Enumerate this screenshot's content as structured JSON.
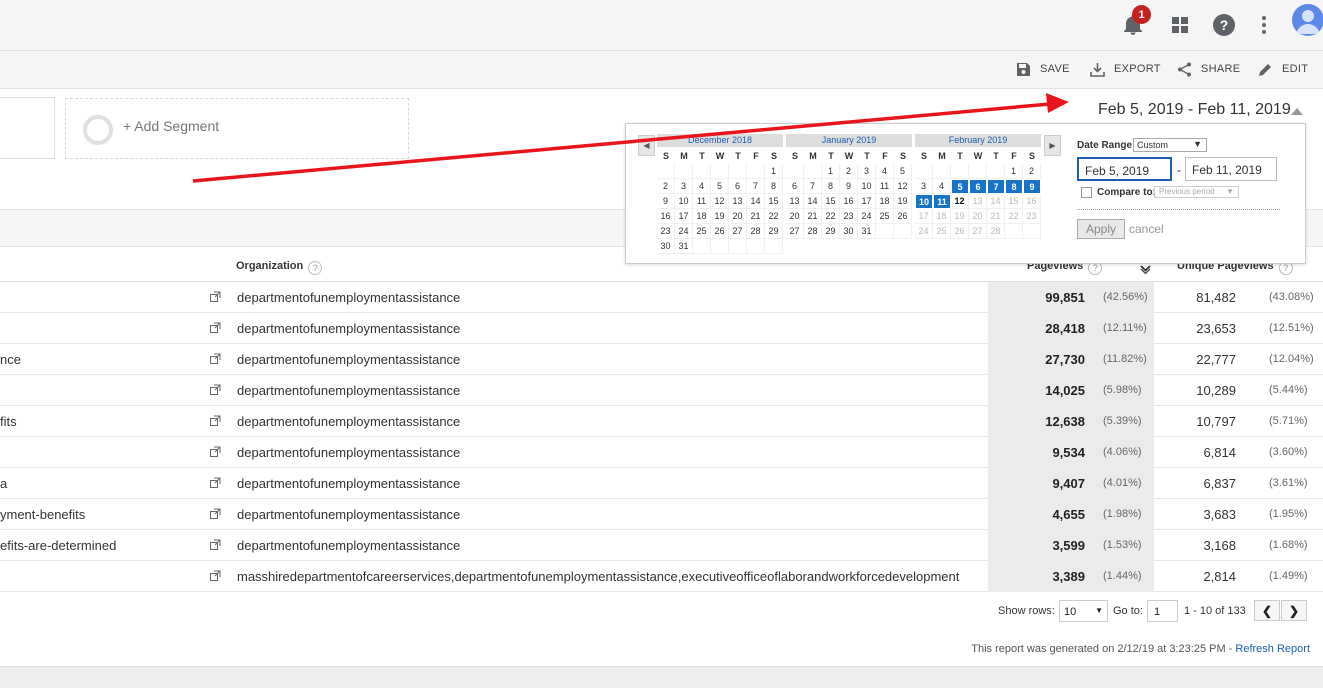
{
  "topbar": {
    "notification_count": "1"
  },
  "toolbar": {
    "save": "SAVE",
    "export": "EXPORT",
    "share": "SHARE",
    "edit": "EDIT"
  },
  "segments": {
    "add_segment": "+ Add Segment"
  },
  "date_range_display": "Feb 5, 2019 - Feb 11, 2019",
  "calendar": {
    "months": [
      {
        "title": "December 2018"
      },
      {
        "title": "January 2019"
      },
      {
        "title": "February 2019"
      }
    ],
    "weekdays": [
      "S",
      "M",
      "T",
      "W",
      "T",
      "F",
      "S"
    ],
    "date_range_label": "Date Range:",
    "date_range_option": "Custom",
    "start_date": "Feb 5, 2019",
    "end_date": "Feb 11, 2019",
    "separator": "-",
    "compare_label": "Compare to:",
    "compare_option": "Previous period",
    "apply": "Apply",
    "cancel": "cancel"
  },
  "table": {
    "headers": {
      "organization": "Organization",
      "pageviews": "Pageviews",
      "unique_pageviews": "Unique Pageviews",
      "help": "?"
    },
    "rows": [
      {
        "page": "",
        "org": "departmentofunemploymentassistance",
        "pv": "99,851",
        "pvp": "(42.56%)",
        "upv": "81,482",
        "upvp": "(43.08%)"
      },
      {
        "page": "",
        "org": "departmentofunemploymentassistance",
        "pv": "28,418",
        "pvp": "(12.11%)",
        "upv": "23,653",
        "upvp": "(12.51%)"
      },
      {
        "page": "nce",
        "org": "departmentofunemploymentassistance",
        "pv": "27,730",
        "pvp": "(11.82%)",
        "upv": "22,777",
        "upvp": "(12.04%)"
      },
      {
        "page": "",
        "org": "departmentofunemploymentassistance",
        "pv": "14,025",
        "pvp": "(5.98%)",
        "upv": "10,289",
        "upvp": "(5.44%)"
      },
      {
        "page": "fits",
        "org": "departmentofunemploymentassistance",
        "pv": "12,638",
        "pvp": "(5.39%)",
        "upv": "10,797",
        "upvp": "(5.71%)"
      },
      {
        "page": "",
        "org": "departmentofunemploymentassistance",
        "pv": "9,534",
        "pvp": "(4.06%)",
        "upv": "6,814",
        "upvp": "(3.60%)"
      },
      {
        "page": "a",
        "org": "departmentofunemploymentassistance",
        "pv": "9,407",
        "pvp": "(4.01%)",
        "upv": "6,837",
        "upvp": "(3.61%)"
      },
      {
        "page": "yment-benefits",
        "org": "departmentofunemploymentassistance",
        "pv": "4,655",
        "pvp": "(1.98%)",
        "upv": "3,683",
        "upvp": "(1.95%)"
      },
      {
        "page": "efits-are-determined",
        "org": "departmentofunemploymentassistance",
        "pv": "3,599",
        "pvp": "(1.53%)",
        "upv": "3,168",
        "upvp": "(1.68%)"
      },
      {
        "page": "",
        "org": "masshiredepartmentofcareerservices,departmentofunemploymentassistance,executiveofficeoflaborandworkforcedevelopment",
        "pv": "3,389",
        "pvp": "(1.44%)",
        "upv": "2,814",
        "upvp": "(1.49%)"
      }
    ]
  },
  "pagination": {
    "show_rows_label": "Show rows:",
    "show_rows_value": "10",
    "goto_label": "Go to:",
    "goto_value": "1",
    "range": "1 - 10 of 133",
    "prev": "❮",
    "next": "❯"
  },
  "report_footer": {
    "generated": "This report was generated on 2/12/19 at 3:23:25 PM - ",
    "refresh": "Refresh Report"
  },
  "colors": {
    "selected_day": "#1673c5",
    "annotation_arrow": "#e8161b",
    "link": "#1a5fb4"
  }
}
